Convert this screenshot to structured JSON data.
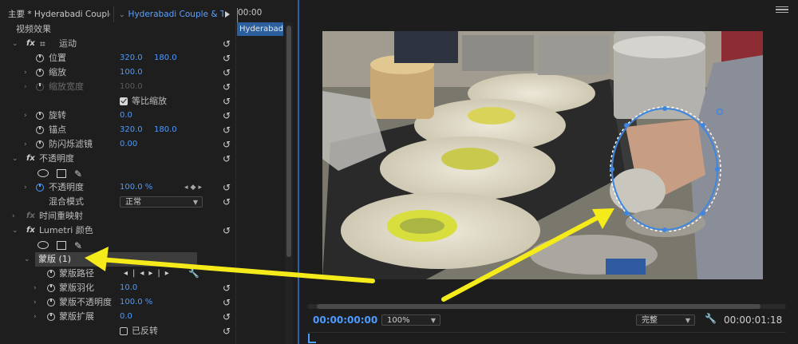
{
  "effect_controls": {
    "tab_master": "主要 * Hyderabadi Couple...",
    "tab_clip": "Hyderabadi Couple & T...",
    "timecode": "00:00",
    "clip_bar_label": "Hyderabadi C",
    "section_video_effects": "视频效果",
    "motion": {
      "label": "运动",
      "position_label": "位置",
      "position_x": "320.0",
      "position_y": "180.0",
      "scale_label": "缩放",
      "scale_value": "100.0",
      "scale_width_label": "缩放宽度",
      "scale_width_value": "100.0",
      "uniform_scale_label": "等比缩放",
      "rotation_label": "旋转",
      "rotation_value": "0.0",
      "anchor_label": "锚点",
      "anchor_x": "320.0",
      "anchor_y": "180.0",
      "antiflicker_label": "防闪烁滤镜",
      "antiflicker_value": "0.00"
    },
    "opacity": {
      "label": "不透明度",
      "opacity_label": "不透明度",
      "opacity_value": "100.0 %",
      "blend_label": "混合模式",
      "blend_value": "正常"
    },
    "time_remap_label": "时间重映射",
    "lumetri": {
      "label": "Lumetri 颜色",
      "mask_label": "蒙版 (1)",
      "mask_path_label": "蒙版路径",
      "mask_feather_label": "蒙版羽化",
      "mask_feather_value": "10.0",
      "mask_opacity_label": "蒙版不透明度",
      "mask_opacity_value": "100.0 %",
      "mask_expansion_label": "蒙版扩展",
      "mask_expansion_value": "0.0",
      "inverted_label": "已反转"
    }
  },
  "program_monitor": {
    "timecode": "00:00:00:00",
    "zoom": "100%",
    "resolution": "完整",
    "duration": "00:00:01:18"
  },
  "icons": {
    "fx": "fx-icon",
    "stopwatch": "stopwatch-icon",
    "reset": "reset-icon",
    "ellipse": "ellipse-mask-icon",
    "rect": "rectangle-mask-icon",
    "pen": "pen-mask-icon",
    "wrench": "wrench-icon",
    "menu": "panel-menu-icon"
  },
  "colors": {
    "accent": "#4d9bff",
    "arrow": "#f5eb1a",
    "mask_outline": "#3e86e0"
  }
}
